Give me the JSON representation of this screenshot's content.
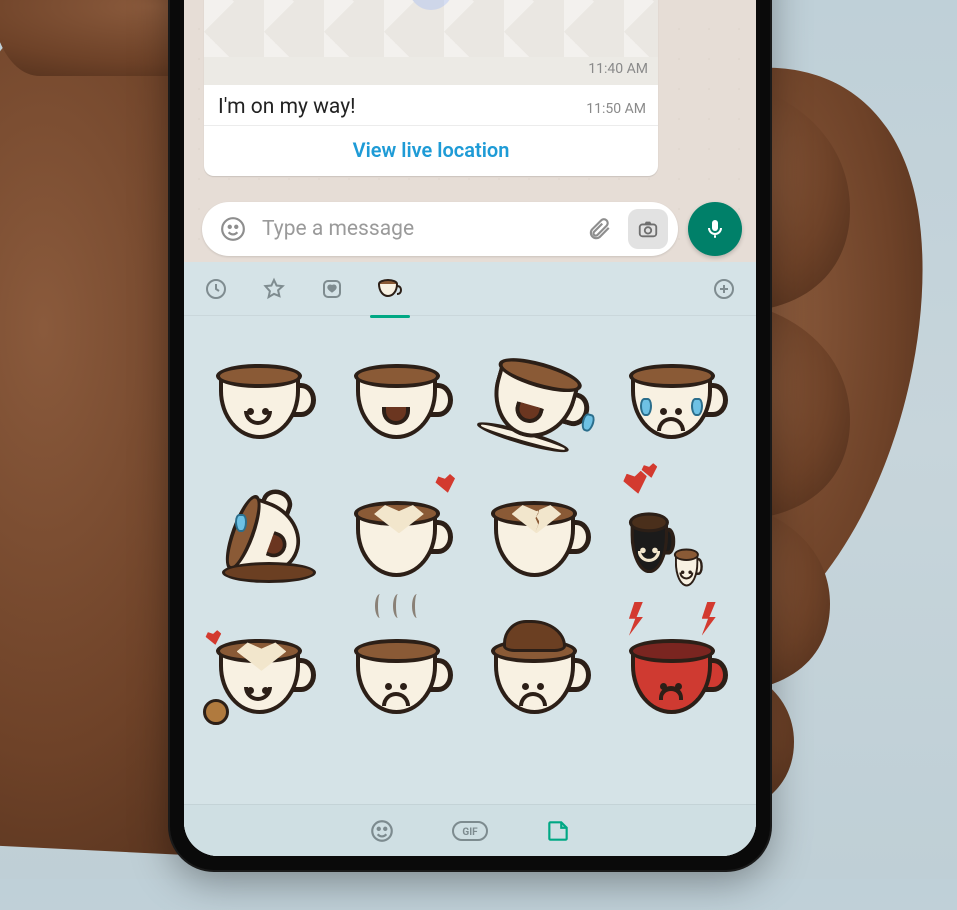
{
  "chat": {
    "location_time": "11:40 AM",
    "message_text": "I'm on my way!",
    "message_time": "11:50 AM",
    "live_location_label": "View live location"
  },
  "input": {
    "placeholder": "Type a message"
  },
  "pack_tabs": {
    "recent": "recent",
    "favorites": "favorites",
    "love": "love",
    "cuppy": "cuppy",
    "add": "add"
  },
  "stickers": [
    {
      "name": "cup-smile"
    },
    {
      "name": "cup-laugh"
    },
    {
      "name": "cup-rofl"
    },
    {
      "name": "cup-cry"
    },
    {
      "name": "cup-sob-spill"
    },
    {
      "name": "cup-latte-heart"
    },
    {
      "name": "cup-latte-broken-heart"
    },
    {
      "name": "cup-couple-heart"
    },
    {
      "name": "cup-heart-cookie"
    },
    {
      "name": "cup-sad-steam"
    },
    {
      "name": "cup-splash-dizzy"
    },
    {
      "name": "cup-red-angry"
    }
  ],
  "bottom_tabs": {
    "emoji": "emoji",
    "gif": "GIF",
    "sticker": "sticker"
  },
  "colors": {
    "accent": "#00a884",
    "mic_bg": "#008069",
    "link": "#1e9bd6"
  }
}
